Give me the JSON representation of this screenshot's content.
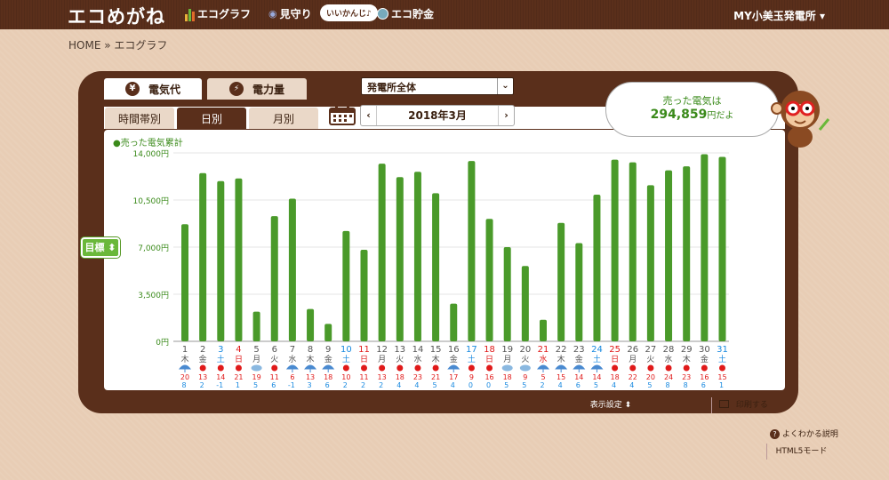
{
  "header": {
    "logo": "エコめがね",
    "nav": [
      {
        "label": "エコグラフ"
      },
      {
        "label": "見守り"
      },
      {
        "label": "エコ貯金"
      }
    ],
    "bubble": "いいかんじ♪",
    "account": "MY小美玉発電所 ▾"
  },
  "breadcrumb": "HOME » エコグラフ",
  "tabs_top": [
    {
      "label": "電気代",
      "icon": "¥",
      "active": true
    },
    {
      "label": "電力量",
      "icon": "⚡",
      "active": false
    }
  ],
  "tabs_sub": [
    {
      "label": "時間帯別",
      "active": false
    },
    {
      "label": "日別",
      "active": true
    },
    {
      "label": "月別",
      "active": false
    }
  ],
  "plant_select": "発電所全体",
  "month_nav": {
    "label": "2018年3月",
    "prev": "‹",
    "next": "›"
  },
  "sold": {
    "line1": "売った電気は",
    "amount": "294,859",
    "unit": "円だよ"
  },
  "goal_button": "目標 ⬍",
  "legend": "●売った電気累計",
  "colors": {
    "bar": "#4a9a2a",
    "brand": "#5a2f1b",
    "red": "#e01a1a",
    "blue": "#1a8ae0"
  },
  "footer": {
    "display_settings": "表示設定 ⬍",
    "print": "印刷する",
    "help": "よくわかる説明",
    "html5": "HTML5モード"
  },
  "chart_data": {
    "type": "bar",
    "legend": "●売った電気累計",
    "ylim": [
      0,
      14000
    ],
    "yticks": [
      "0円",
      "3,500円",
      "7,000円",
      "10,500円",
      "14,000円"
    ],
    "categories": [
      "1",
      "2",
      "3",
      "4",
      "5",
      "6",
      "7",
      "8",
      "9",
      "10",
      "11",
      "12",
      "13",
      "14",
      "15",
      "16",
      "17",
      "18",
      "19",
      "20",
      "21",
      "22",
      "23",
      "24",
      "25",
      "26",
      "27",
      "28",
      "29",
      "30",
      "31"
    ],
    "weekdays": [
      "木",
      "金",
      "土",
      "日",
      "月",
      "火",
      "水",
      "木",
      "金",
      "土",
      "日",
      "月",
      "火",
      "水",
      "木",
      "金",
      "土",
      "日",
      "月",
      "火",
      "水",
      "木",
      "金",
      "土",
      "日",
      "月",
      "火",
      "水",
      "木",
      "金",
      "土"
    ],
    "values": [
      8700,
      12500,
      11900,
      12100,
      2200,
      9300,
      10600,
      2400,
      1300,
      8200,
      6800,
      13200,
      12200,
      12600,
      11000,
      2800,
      13400,
      9100,
      7000,
      5600,
      1600,
      8800,
      7300,
      10900,
      13500,
      13300,
      11600,
      12700,
      13000,
      13900,
      13700
    ],
    "high_temps": [
      "20",
      "13",
      "14",
      "21",
      "19",
      "11",
      "6",
      "13",
      "18",
      "10",
      "11",
      "13",
      "18",
      "23",
      "21",
      "17",
      "9",
      "16",
      "18",
      "9",
      "5",
      "15",
      "14",
      "14",
      "18",
      "22",
      "20",
      "24",
      "23",
      "16",
      "15"
    ],
    "low_temps": [
      "8",
      "2",
      "-1",
      "1",
      "5",
      "6",
      "-1",
      "3",
      "6",
      "2",
      "2",
      "2",
      "4",
      "4",
      "5",
      "4",
      "0",
      "0",
      "5",
      "5",
      "2",
      "4",
      "6",
      "5",
      "4",
      "4",
      "5",
      "8",
      "8",
      "6",
      "1"
    ],
    "weather": [
      "rain",
      "sun",
      "sun",
      "sun",
      "cloud",
      "sun",
      "rain",
      "rain",
      "rain",
      "sun",
      "sun",
      "sun",
      "sun",
      "sun",
      "sun",
      "rain",
      "sun",
      "sun",
      "cloud",
      "cloud",
      "rain",
      "rain",
      "rain",
      "rain",
      "sun",
      "sun",
      "sun",
      "sun",
      "sun",
      "sun",
      "sun"
    ]
  }
}
